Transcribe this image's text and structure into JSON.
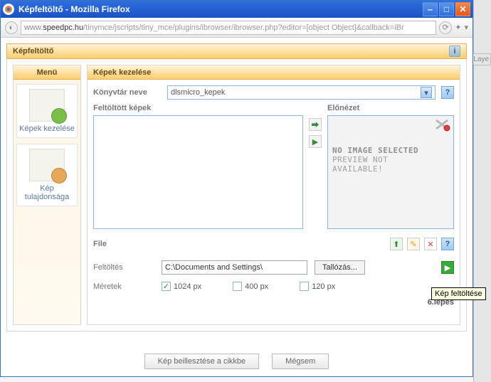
{
  "window": {
    "title": "Képfeltöltő - Mozilla Firefox"
  },
  "url": {
    "prefix": "www.",
    "host": "speedpc.hu",
    "path": "/tinymce/jscripts/tiny_mce/plugins/ibrowser/ibrowser.php?editor=[object Object]&callback=iBr"
  },
  "panel": {
    "title": "Képfeltöltő"
  },
  "sidebar": {
    "title": "Menü",
    "items": [
      {
        "label": "Képek kezelése"
      },
      {
        "label": "Kép tulajdonsága"
      }
    ]
  },
  "main": {
    "title": "Képek kezelése",
    "dir_label": "Könyvtár neve",
    "dir_value": "dlsmicro_kepek",
    "uploaded_label": "Feltöltött képek",
    "preview_label": "Előnézet",
    "preview_no_image": "NO IMAGE SELECTED",
    "preview_line2": "PREVIEW NOT",
    "preview_line3": "AVAILABLE!",
    "file_label": "File",
    "upload_label": "Feltöltés",
    "upload_path": "C:\\Documents and Settings\\",
    "browse_label": "Tallózás...",
    "sizes_label": "Méretek",
    "sizes": [
      {
        "label": "1024 px",
        "checked": true
      },
      {
        "label": "400 px",
        "checked": false
      },
      {
        "label": "120 px",
        "checked": false
      }
    ],
    "step": "6.lépés"
  },
  "buttons": {
    "insert": "Kép beillesztése a cikkbe",
    "cancel": "Mégsem"
  },
  "tooltip": "Kép feltöltése",
  "layers": "(Laye"
}
